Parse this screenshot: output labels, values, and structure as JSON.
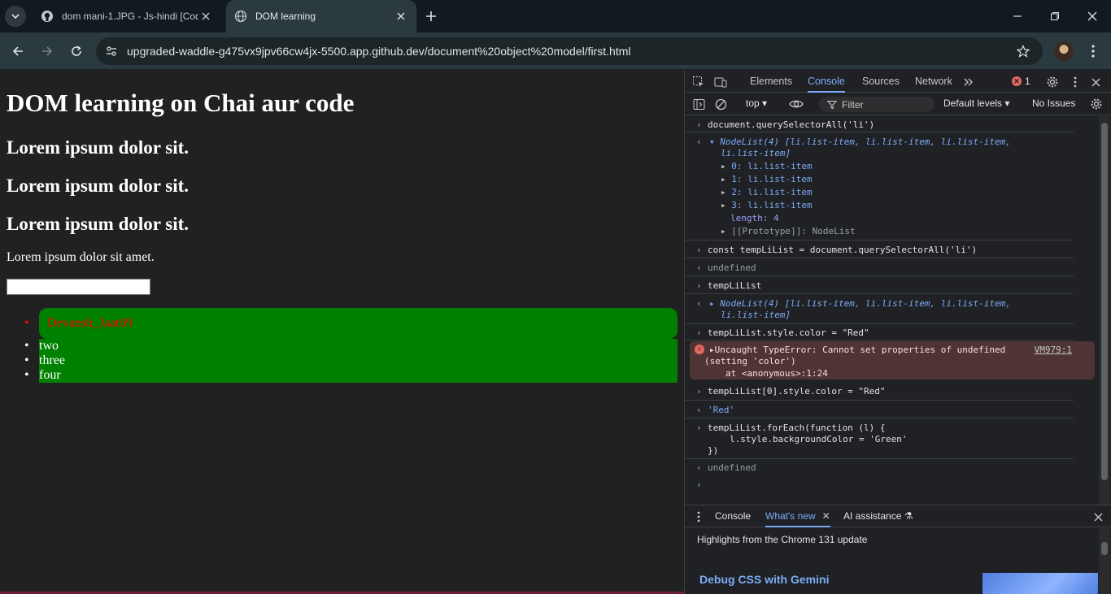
{
  "browser": {
    "tabs": [
      {
        "title": "dom mani-1.JPG - Js-hindi [Cod",
        "active": false
      },
      {
        "title": "DOM learning",
        "active": true
      }
    ],
    "url": "upgraded-waddle-g475vx9jpv66cw4jx-5500.app.github.dev/document%20object%20model/first.html"
  },
  "page": {
    "heading": "DOM learning on Chai aur code",
    "subheadings": [
      "Lorem ipsum dolor sit.",
      "Lorem ipsum dolor sit.",
      "Lorem ipsum dolor sit."
    ],
    "paragraph": "Lorem ipsum dolor sit amet.",
    "input_value": "",
    "list_items": [
      "Devansh_Jaat09",
      "two",
      "three",
      "four"
    ],
    "colors": {
      "page_bg": "#212121",
      "list_bg": "#008000",
      "first_item_text": "#ff0000"
    }
  },
  "devtools": {
    "tabs": [
      "Elements",
      "Console",
      "Sources",
      "Network"
    ],
    "active_tab": "Console",
    "error_count": "1",
    "context": "top",
    "filter_placeholder": "Filter",
    "levels": "Default levels",
    "issues": "No Issues",
    "console": {
      "cmd1": "document.querySelectorAll('li')",
      "nodelist_head": "NodeList(4) [li.list-item, li.list-item, li.list-item,",
      "nodelist_head2": "li.list-item]",
      "items": [
        "0: li.list-item",
        "1: li.list-item",
        "2: li.list-item",
        "3: li.list-item"
      ],
      "length": "length: 4",
      "prototype": "[[Prototype]]: NodeList",
      "cmd2": "const tempLiList = document.querySelectorAll('li')",
      "result_undefined": "undefined",
      "cmd3": "tempLiList",
      "cmd4": "tempLiList.style.color = \"Red\"",
      "error_line1": "Uncaught TypeError: Cannot set properties of undefined",
      "error_line2": "(setting 'color')",
      "error_line3": "at <anonymous>:1:24",
      "error_source": "VM979:1",
      "cmd5": "tempLiList[0].style.color = \"Red\"",
      "result_red": "'Red'",
      "cmd6_line1": "tempLiList.forEach(function (l) {",
      "cmd6_line2": "l.style.backgroundColor = 'Green'",
      "cmd6_line3": "})"
    },
    "drawer": {
      "tabs": [
        "Console",
        "What's new",
        "AI assistance"
      ],
      "active_tab": "What's new",
      "highlights": "Highlights from the Chrome 131 update",
      "feature_title": "Debug CSS with Gemini"
    }
  }
}
